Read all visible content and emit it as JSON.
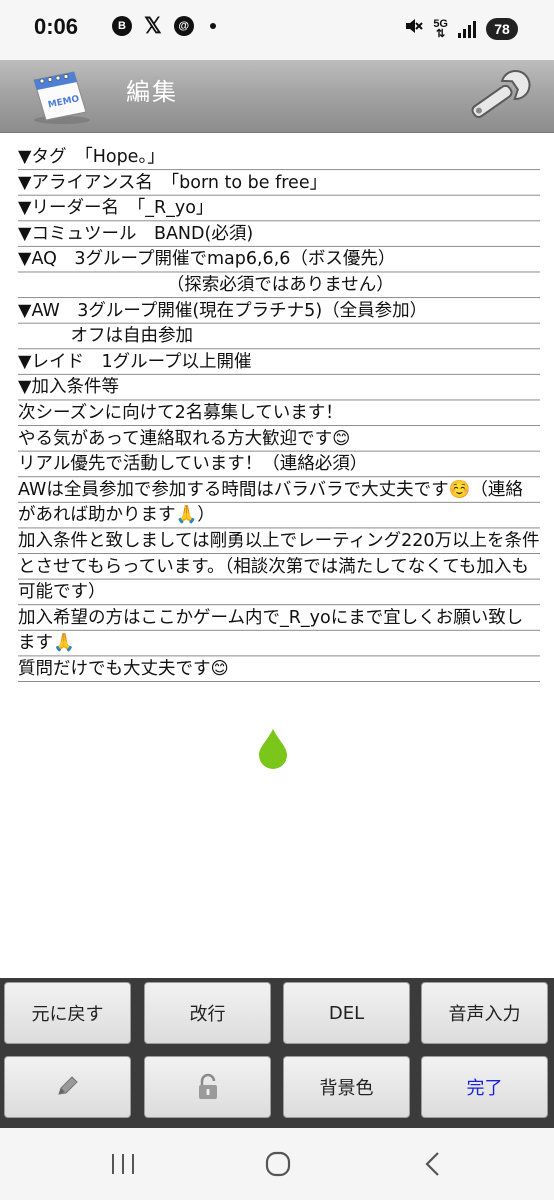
{
  "status_bar": {
    "time": "0:06",
    "icons_left": [
      "b-notification-icon",
      "x-icon",
      "threads-icon",
      "dot-icon"
    ],
    "icon_b_text": "B",
    "icon_x_text": "𝕏",
    "icon_threads_text": "@",
    "network": "5G",
    "battery": "78"
  },
  "header": {
    "title": "編集"
  },
  "memo": {
    "text": "▼タグ　「Hope。」\n▼アライアンス名　「born to be free」\n▼リーダー名　「_R_yo」\n▼コミュツール　BAND(必須)\n▼AQ　3グループ開催でmap6,6,6（ボス優先）\n　　　　　　　　　（探索必須ではありません）\n▼AW　3グループ開催(現在プラチナ5)（全員参加）\n　　　オフは自由参加\n▼レイド　1グループ以上開催\n▼加入条件等\n次シーズンに向けて2名募集しています！\nやる気があって連絡取れる方大歓迎です😊\nリアル優先で活動しています！（連絡必須）\nAWは全員参加で参加する時間はバラバラで大丈夫です☺️（連絡があれば助かります🙏）\n加入条件と致しましては剛勇以上でレーティング220万以上を条件とさせてもらっています。（相談次第では満たしてなくても加入も可能です）\n加入希望の方はここかゲーム内で_R_yoにまで宜しくお願い致します🙏\n質問だけでも大丈夫です😊"
  },
  "toolbar": {
    "undo": "元に戻す",
    "newline": "改行",
    "delete": "DEL",
    "voice": "音声入力",
    "background": "背景色",
    "done": "完了"
  },
  "colors": {
    "header_gradient_top": "#bdbdbd",
    "header_gradient_bottom": "#8c8c8c",
    "toolbar_bg": "#3b3b3b",
    "done_text": "#1a22d8",
    "cursor_drop": "#7ac61a"
  }
}
